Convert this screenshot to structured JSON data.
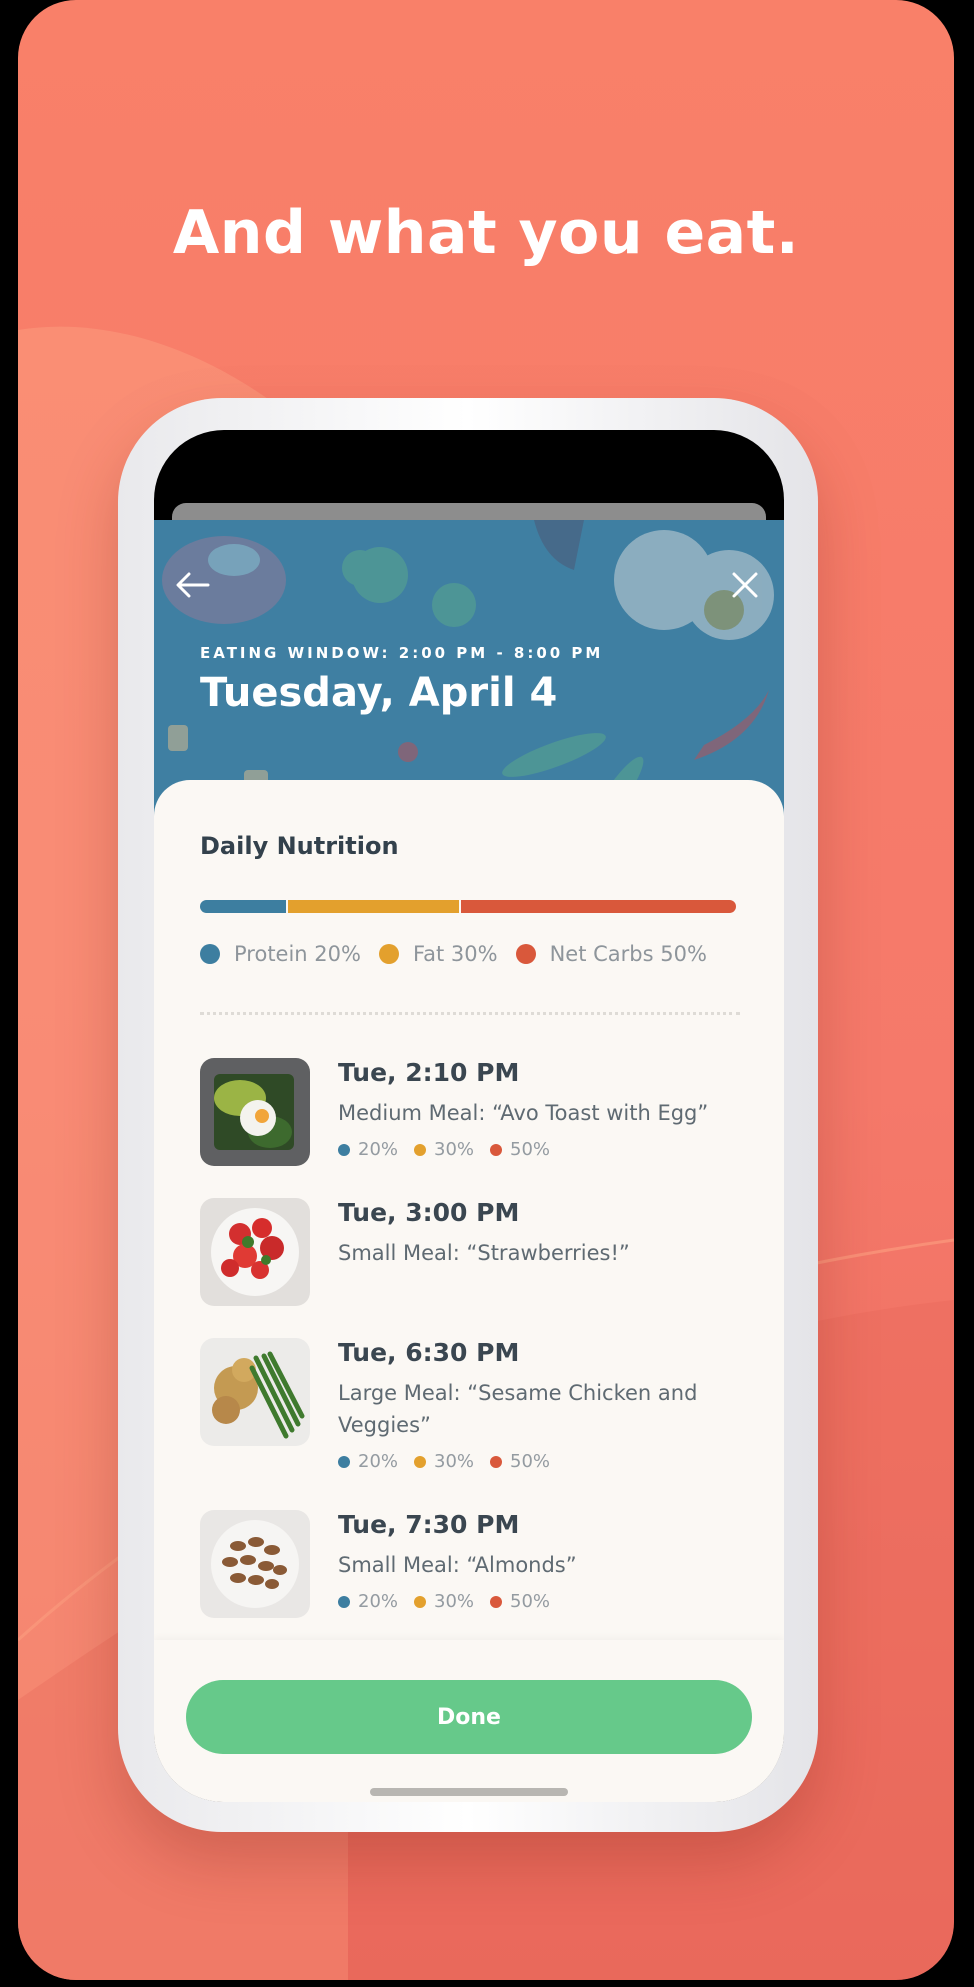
{
  "headline": "And what you eat.",
  "header": {
    "eating_window": "EATING WINDOW: 2:00 PM - 8:00 PM",
    "date": "Tuesday, April 4"
  },
  "nutrition": {
    "title": "Daily Nutrition",
    "macros": [
      {
        "label": "Protein 20%",
        "percent": 20,
        "color": "#3d7ea0"
      },
      {
        "label": "Fat 30%",
        "percent": 30,
        "color": "#e3a02d"
      },
      {
        "label": "Net Carbs 50%",
        "percent": 50,
        "color": "#d9583b"
      }
    ]
  },
  "meals": [
    {
      "time": "Tue, 2:10 PM",
      "desc": "Medium Meal: “Avo Toast with Egg”",
      "macros": [
        "20%",
        "30%",
        "50%"
      ],
      "photo": "avocado-toast"
    },
    {
      "time": "Tue, 3:00 PM",
      "desc": "Small Meal: “Strawberries!”",
      "macros": [],
      "photo": "strawberries"
    },
    {
      "time": "Tue, 6:30 PM",
      "desc": "Large Meal: “Sesame Chicken and Veggies”",
      "macros": [
        "20%",
        "30%",
        "50%"
      ],
      "photo": "sesame-chicken"
    },
    {
      "time": "Tue, 7:30 PM",
      "desc": "Small Meal: “Almonds”",
      "macros": [
        "20%",
        "30%",
        "50%"
      ],
      "photo": "almonds"
    }
  ],
  "done_label": "Done",
  "colors": {
    "background": "#f98069",
    "header": "#3f7fa2",
    "protein": "#3d7ea0",
    "fat": "#e3a02d",
    "carbs": "#d9583b",
    "done_button": "#66c98a"
  },
  "icons": {
    "back": "arrow-left-icon",
    "close": "close-icon"
  }
}
